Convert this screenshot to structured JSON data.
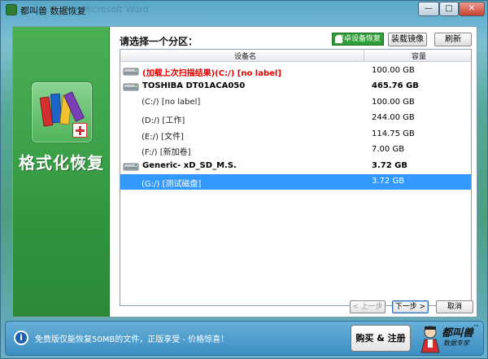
{
  "window": {
    "title": "都叫兽 数据恢复",
    "title_ghost": "Microsoft Word",
    "minimize_glyph": "—",
    "maximize_glyph": "□",
    "close_glyph": "✕"
  },
  "sidebar": {
    "logo_icon": "books-rescue-icon",
    "title": "格式化恢复"
  },
  "main": {
    "heading": "请选择一个分区：",
    "android_button": "安卓设备恢复",
    "mirror_button": "装载镜像",
    "refresh_button": "刷新"
  },
  "table": {
    "columns": [
      "设备名",
      "容量"
    ],
    "rows": [
      {
        "type": "disk",
        "name": "(加载上次扫描结果)(C:/) [no label]",
        "capacity": "100.00 GB",
        "style": "red"
      },
      {
        "type": "disk",
        "name": "TOSHIBA DT01ACA050",
        "capacity": "465.76 GB",
        "style": "bold"
      },
      {
        "type": "partition",
        "name": "(C:/) [no label]",
        "capacity": "100.00 GB",
        "style": "normal"
      },
      {
        "type": "partition",
        "name": "(D:/) [工作]",
        "capacity": "244.00 GB",
        "style": "normal"
      },
      {
        "type": "partition",
        "name": "(E:/) [文件]",
        "capacity": "114.75 GB",
        "style": "normal"
      },
      {
        "type": "partition",
        "name": "(F:/) [新加卷]",
        "capacity": "7.00 GB",
        "style": "normal"
      },
      {
        "type": "disk",
        "name": "Generic- xD_SD_M.S.",
        "capacity": "3.72 GB",
        "style": "bold"
      },
      {
        "type": "partition",
        "name": "(G:/) [测试磁盘]",
        "capacity": "3.72 GB",
        "style": "selected"
      }
    ]
  },
  "nav": {
    "prev": "< 上一步",
    "next": "下一步 >",
    "cancel": "取消"
  },
  "footer": {
    "info_glyph": "i",
    "message": "免费版仅能恢复50MB的文件，正版享受 - 价格惊喜！",
    "buy_button": "购买 & 注册",
    "brand": "都叫兽",
    "brand_sub": "数据专家",
    "brand_tm": "™"
  },
  "colors": {
    "sidebar_green": "#3da24a",
    "selection_blue": "#3399ff",
    "footer_blue": "#3d8ec4",
    "alert_red": "#e00000"
  }
}
